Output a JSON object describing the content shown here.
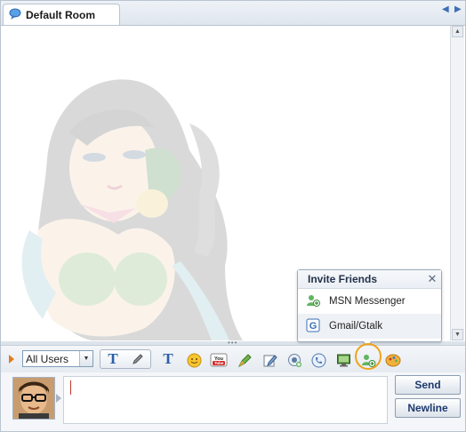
{
  "room_tab": {
    "title": "Default Room"
  },
  "popup": {
    "title": "Invite Friends",
    "items": [
      {
        "label": "MSN Messenger",
        "icon": "msn-add-icon"
      },
      {
        "label": "Gmail/Gtalk",
        "icon": "gtalk-icon"
      }
    ]
  },
  "toolbar": {
    "user_filter": "All Users",
    "icons": [
      "text-format-icon",
      "pen-icon",
      "font-icon",
      "smiley-icon",
      "youtube-icon",
      "paint-icon",
      "edit-icon",
      "camera-add-icon",
      "phone-icon",
      "screen-share-icon",
      "invite-friends-icon",
      "theme-icon"
    ]
  },
  "composer": {
    "send_label": "Send",
    "newline_label": "Newline"
  },
  "colors": {
    "accent": "#2a5ea8",
    "highlight": "#f0a21a",
    "border": "#b9c4d0"
  }
}
